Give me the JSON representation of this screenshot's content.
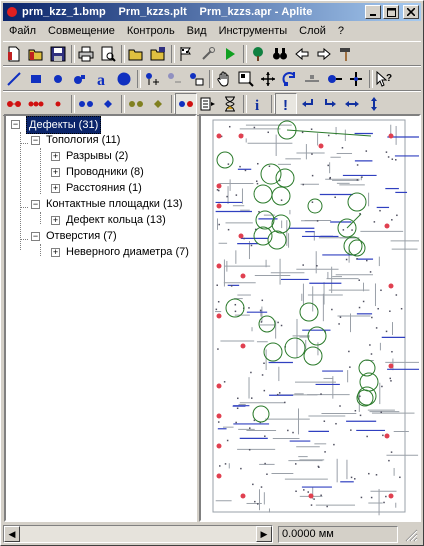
{
  "window": {
    "title": "prm_kzz_1.bmp    Prm_kzzs.plt    Prm_kzzs.apr - Aplite",
    "controls": [
      "minimize",
      "maximize",
      "close"
    ]
  },
  "menu": [
    {
      "label": "Файл"
    },
    {
      "label": "Совмещение"
    },
    {
      "label": "Контроль"
    },
    {
      "label": "Вид"
    },
    {
      "label": "Инструменты"
    },
    {
      "label": "Слой"
    },
    {
      "label": "?"
    }
  ],
  "toolbars": {
    "row1": [
      "new-file-icon",
      "open-folder-icon",
      "save-icon",
      "print-icon",
      "print-preview-icon",
      "open-layer-icon",
      "open-layer-2-icon",
      "flag-icon",
      "tools-icon",
      "play-icon",
      "tree-icon",
      "binoculars-icon",
      "arrow-left-icon",
      "arrow-right-icon",
      "hammer-icon"
    ],
    "row2": [
      "line-tool-icon",
      "rect-tool-icon",
      "circle-tool-icon",
      "pad-tool-icon",
      "text-tool-icon",
      "big-circle-icon",
      "add-point-icon",
      "remove-point-icon",
      "replace-icon",
      "hand-icon",
      "zoom-window-icon",
      "move-icon",
      "rotate-icon",
      "connect-icon",
      "node-icon",
      "align-icon",
      "help-cursor-icon"
    ],
    "row3": [
      "defects-red-pairs-icon",
      "defects-red-triple-icon",
      "defect-red-small-icon",
      "defects-blue-pairs-icon",
      "defect-blue-small-icon",
      "defects-olive-pairs-icon",
      "defect-olive-small-icon",
      "compare-icon",
      "report-icon",
      "hourglass-icon",
      "info-icon",
      "exclamation-icon",
      "step-back-icon",
      "step-forward-icon",
      "horizontal-arrows-icon",
      "vertical-arrows-icon"
    ]
  },
  "tree": {
    "root": "Дефекты (31)",
    "topology": "Топология (11)",
    "breaks": "Разрывы (2)",
    "conductors": "Проводники (8)",
    "distances": "Расстояния (1)",
    "pads": "Контактные площадки (13)",
    "ring_defect": "Дефект кольца (13)",
    "holes": "Отверстия (7)",
    "wrong_diameter": "Неверного диаметра (7)"
  },
  "status": {
    "coordinate": "0.0000 мм"
  },
  "colors": {
    "title_start": "#0a246a",
    "title_end": "#a6caf0",
    "defect_circle": "#2a7a2a",
    "pad_red": "#e04050",
    "trace_blue": "#3040c0",
    "trace_gray": "#9aa0a8"
  }
}
